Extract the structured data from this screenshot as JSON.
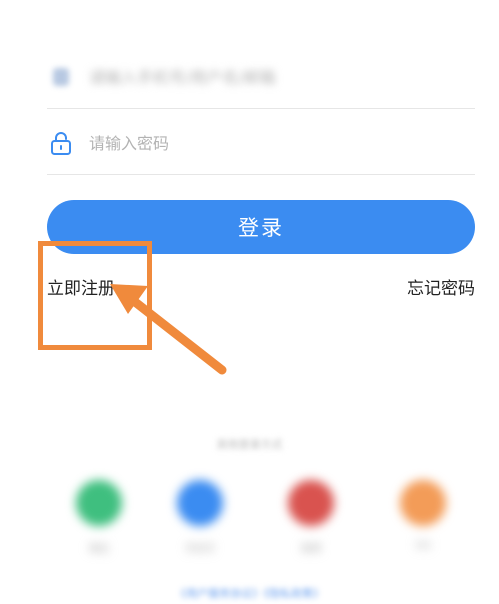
{
  "form": {
    "phone_placeholder": "请输入手机号/用户名/邮箱",
    "password_placeholder": "请输入密码",
    "login_label": "登录"
  },
  "links": {
    "register": "立即注册",
    "forgot": "忘记密码"
  },
  "divider": {
    "text": "其他登录方式"
  },
  "third_party": [
    {
      "label": "微信",
      "color": "#3fbf7f"
    },
    {
      "label": "手机号",
      "color": "#3b8cf1"
    },
    {
      "label": "微博",
      "color": "#d9534f"
    },
    {
      "label": "QQ",
      "color": "#f39c58"
    }
  ],
  "agreement": {
    "text": "《用户服务协议》《隐私政策》"
  },
  "colors": {
    "accent": "#3b8cf1",
    "annotation": "#f08a3c"
  }
}
